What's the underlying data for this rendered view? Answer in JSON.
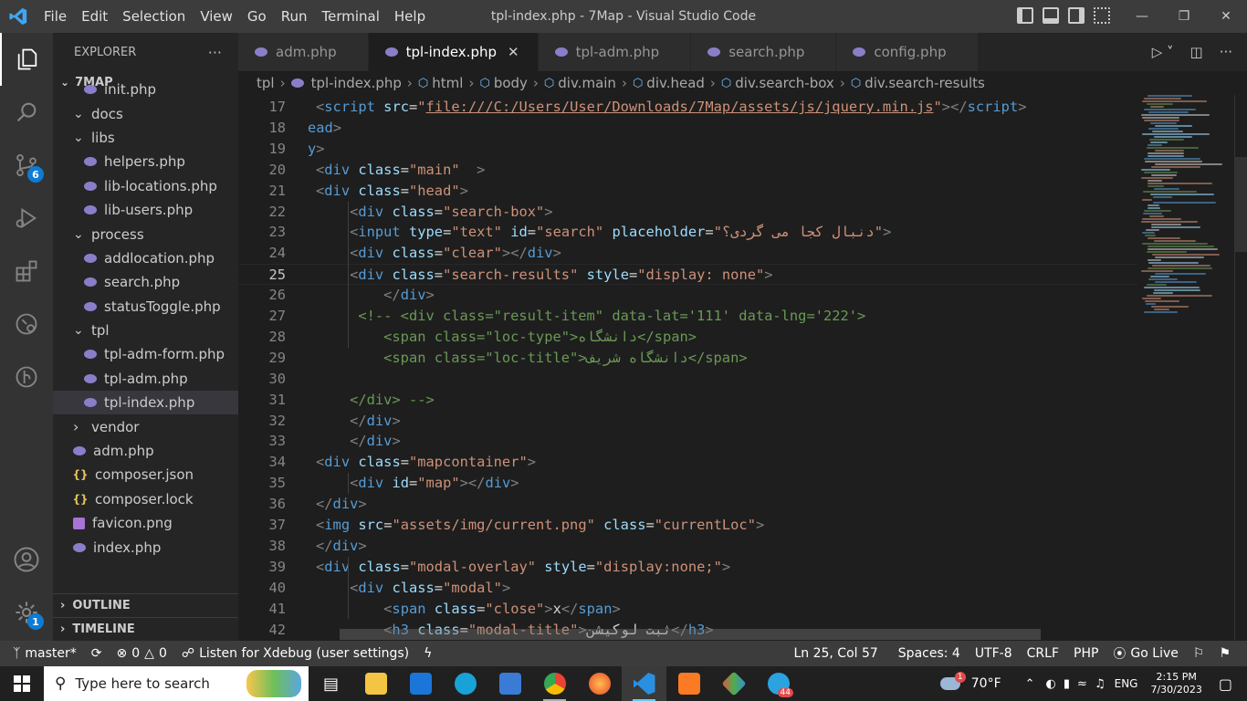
{
  "window": {
    "title": "tpl-index.php - 7Map - Visual Studio Code",
    "menu": [
      "File",
      "Edit",
      "Selection",
      "View",
      "Go",
      "Run",
      "Terminal",
      "Help"
    ]
  },
  "activity": {
    "source_control_badge": "6",
    "settings_badge": "1"
  },
  "explorer": {
    "header": "EXPLORER",
    "more": "···",
    "project": "7MAP",
    "items": [
      {
        "label": "init.php",
        "depth": 2,
        "kind": "php"
      },
      {
        "label": "docs",
        "depth": 1,
        "kind": "folder",
        "open": true
      },
      {
        "label": "libs",
        "depth": 1,
        "kind": "folder",
        "open": true
      },
      {
        "label": "helpers.php",
        "depth": 2,
        "kind": "php"
      },
      {
        "label": "lib-locations.php",
        "depth": 2,
        "kind": "php"
      },
      {
        "label": "lib-users.php",
        "depth": 2,
        "kind": "php"
      },
      {
        "label": "process",
        "depth": 1,
        "kind": "folder",
        "open": true
      },
      {
        "label": "addlocation.php",
        "depth": 2,
        "kind": "php"
      },
      {
        "label": "search.php",
        "depth": 2,
        "kind": "php"
      },
      {
        "label": "statusToggle.php",
        "depth": 2,
        "kind": "php"
      },
      {
        "label": "tpl",
        "depth": 1,
        "kind": "folder",
        "open": true
      },
      {
        "label": "tpl-adm-form.php",
        "depth": 2,
        "kind": "php"
      },
      {
        "label": "tpl-adm.php",
        "depth": 2,
        "kind": "php"
      },
      {
        "label": "tpl-index.php",
        "depth": 2,
        "kind": "php",
        "selected": true
      },
      {
        "label": "vendor",
        "depth": 1,
        "kind": "folder",
        "open": false
      },
      {
        "label": "adm.php",
        "depth": 1,
        "kind": "php"
      },
      {
        "label": "composer.json",
        "depth": 1,
        "kind": "json"
      },
      {
        "label": "composer.lock",
        "depth": 1,
        "kind": "json"
      },
      {
        "label": "favicon.png",
        "depth": 1,
        "kind": "png"
      },
      {
        "label": "index.php",
        "depth": 1,
        "kind": "php"
      }
    ],
    "outline": "OUTLINE",
    "timeline": "TIMELINE"
  },
  "tabs": [
    {
      "label": "adm.php",
      "active": false
    },
    {
      "label": "tpl-index.php",
      "active": true
    },
    {
      "label": "tpl-adm.php",
      "active": false
    },
    {
      "label": "search.php",
      "active": false
    },
    {
      "label": "config.php",
      "active": false
    }
  ],
  "breadcrumb": [
    "tpl",
    "tpl-index.php",
    "html",
    "body",
    "div.main",
    "div.head",
    "div.search-box",
    "div.search-results"
  ],
  "code": {
    "current_line": 25,
    "lines": [
      {
        "n": "17",
        "html": "<span class=\"ang\">&lt;</span><span class=\"tag\">script</span> <span class=\"att\">src</span>=<span class=\"str\">\"<span class=\"link\">file:///C:/Users/User/Downloads/7Map/assets/js/jquery.min.js</span>\"</span><span class=\"ang\">&gt;&lt;/</span><span class=\"tag\">script</span><span class=\"ang\">&gt;</span>"
      },
      {
        "n": "18",
        "html": "<span class=\"tag\">ead</span><span class=\"ang\">&gt;</span>",
        "shift": -9
      },
      {
        "n": "19",
        "html": "<span class=\"tag\">y</span><span class=\"ang\">&gt;</span>",
        "shift": -9
      },
      {
        "n": "20",
        "html": "<span class=\"ang\">&lt;</span><span class=\"tag\">div</span> <span class=\"att\">class</span>=<span class=\"str\">\"main\"</span>  <span class=\"ang\">&gt;</span>"
      },
      {
        "n": "21",
        "html": "<span class=\"ang\">&lt;</span><span class=\"tag\">div</span> <span class=\"att\">class</span>=<span class=\"str\">\"head\"</span><span class=\"ang\">&gt;</span>"
      },
      {
        "n": "22",
        "html": "    <span class=\"ang\">&lt;</span><span class=\"tag\">div</span> <span class=\"att\">class</span>=<span class=\"str\">\"search-box\"</span><span class=\"ang\">&gt;</span>"
      },
      {
        "n": "23",
        "html": "    <span class=\"ang\">&lt;</span><span class=\"tag\">input</span> <span class=\"att\">type</span>=<span class=\"str\">\"text\"</span> <span class=\"att\">id</span>=<span class=\"str\">\"search\"</span> <span class=\"att\">placeholder</span>=<span class=\"str\">\"دنبال کجا می گردی؟\"</span><span class=\"ang\">&gt;</span>"
      },
      {
        "n": "24",
        "html": "    <span class=\"ang\">&lt;</span><span class=\"tag\">div</span> <span class=\"att\">class</span>=<span class=\"str\">\"clear\"</span><span class=\"ang\">&gt;&lt;/</span><span class=\"tag\">div</span><span class=\"ang\">&gt;</span>"
      },
      {
        "n": "25",
        "html": "    <span class=\"ang\">&lt;</span><span class=\"tag\">div</span> <span class=\"att\">class</span>=<span class=\"str\">\"search-results\"</span> <span class=\"att\">style</span>=<span class=\"str\">\"display: none\"</span><span class=\"ang\">&gt;</span>"
      },
      {
        "n": "26",
        "html": "        <span class=\"ang\">&lt;/</span><span class=\"tag\">div</span><span class=\"ang\">&gt;</span>"
      },
      {
        "n": "27",
        "html": "     <span class=\"cmt\">&lt;!-- &lt;div class=\"result-item\" data-lat='111' data-lng='222'&gt;</span>"
      },
      {
        "n": "28",
        "html": "        <span class=\"cmt\">&lt;span class=\"loc-type\"&gt;دانشگاه&lt;/span&gt;</span>"
      },
      {
        "n": "29",
        "html": "        <span class=\"cmt\">&lt;span class=\"loc-title\"&gt;دانشگاه شریف&lt;/span&gt;</span>"
      },
      {
        "n": "30",
        "html": ""
      },
      {
        "n": "31",
        "html": "    <span class=\"cmt\">&lt;/div&gt; --&gt;</span>"
      },
      {
        "n": "32",
        "html": "    <span class=\"ang\">&lt;/</span><span class=\"tag\">div</span><span class=\"ang\">&gt;</span>"
      },
      {
        "n": "33",
        "html": "    <span class=\"ang\">&lt;/</span><span class=\"tag\">div</span><span class=\"ang\">&gt;</span>"
      },
      {
        "n": "34",
        "html": "<span class=\"ang\">&lt;</span><span class=\"tag\">div</span> <span class=\"att\">class</span>=<span class=\"str\">\"mapcontainer\"</span><span class=\"ang\">&gt;</span>"
      },
      {
        "n": "35",
        "html": "    <span class=\"ang\">&lt;</span><span class=\"tag\">div</span> <span class=\"att\">id</span>=<span class=\"str\">\"map\"</span><span class=\"ang\">&gt;&lt;/</span><span class=\"tag\">div</span><span class=\"ang\">&gt;</span>"
      },
      {
        "n": "36",
        "html": "<span class=\"ang\">&lt;/</span><span class=\"tag\">div</span><span class=\"ang\">&gt;</span>"
      },
      {
        "n": "37",
        "html": "<span class=\"ang\">&lt;</span><span class=\"tag\">img</span> <span class=\"att\">src</span>=<span class=\"str\">\"assets/img/current.png\"</span> <span class=\"att\">class</span>=<span class=\"str\">\"currentLoc\"</span><span class=\"ang\">&gt;</span>"
      },
      {
        "n": "38",
        "html": "<span class=\"ang\">&lt;/</span><span class=\"tag\">div</span><span class=\"ang\">&gt;</span>"
      },
      {
        "n": "39",
        "html": "<span class=\"ang\">&lt;</span><span class=\"tag\">div</span> <span class=\"att\">class</span>=<span class=\"str\">\"modal-overlay\"</span> <span class=\"att\">style</span>=<span class=\"str\">\"display:none;\"</span><span class=\"ang\">&gt;</span>"
      },
      {
        "n": "40",
        "html": "    <span class=\"ang\">&lt;</span><span class=\"tag\">div</span> <span class=\"att\">class</span>=<span class=\"str\">\"modal\"</span><span class=\"ang\">&gt;</span>"
      },
      {
        "n": "41",
        "html": "        <span class=\"ang\">&lt;</span><span class=\"tag\">span</span> <span class=\"att\">class</span>=<span class=\"str\">\"close\"</span><span class=\"ang\">&gt;</span><span class=\"txt\">x</span><span class=\"ang\">&lt;/</span><span class=\"tag\">span</span><span class=\"ang\">&gt;</span>"
      },
      {
        "n": "42",
        "html": "        <span class=\"ang\">&lt;</span><span class=\"tag\">h3</span> <span class=\"att\">class</span>=<span class=\"str\">\"modal-title\"</span><span class=\"ang\">&gt;</span><span class=\"txt\">ثبت لوکیشن</span><span class=\"ang\">&lt;/</span><span class=\"tag\">h3</span><span class=\"ang\">&gt;</span>"
      }
    ]
  },
  "statusbar": {
    "branch": "master*",
    "errors": "0",
    "warnings": "0",
    "xdebug": "Listen for Xdebug (user settings)",
    "position": "Ln 25, Col 57",
    "spaces": "Spaces: 4",
    "encoding": "UTF-8",
    "eol": "CRLF",
    "language": "PHP",
    "golive": "Go Live"
  },
  "taskbar": {
    "search_placeholder": "Type here to search",
    "weather": "70°F",
    "weather_badge": "1",
    "language": "ENG",
    "time": "2:15 PM",
    "date": "7/30/2023",
    "telegram_badge": "44"
  },
  "colors": {
    "accent": "#0e7bd4",
    "php_icon": "#8b7ec9",
    "tag": "#569cd6",
    "attribute": "#9cdcfe",
    "string": "#ce9178",
    "comment": "#6a9955"
  }
}
